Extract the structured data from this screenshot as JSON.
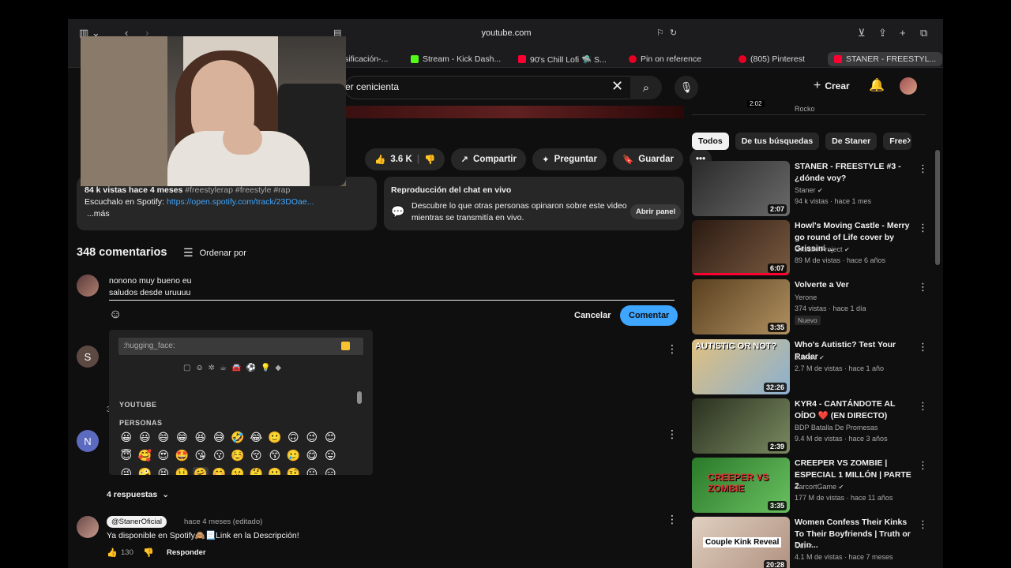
{
  "browser": {
    "url": "youtube.com",
    "tabs": [
      {
        "label": "sificación-..."
      },
      {
        "label": "Stream - Kick Dash..."
      },
      {
        "label": "90's Chill Lofi 🛸 S..."
      },
      {
        "label": "Pin on reference"
      },
      {
        "label": "(805) Pinterest"
      },
      {
        "label": "STANER - FREESTYL..."
      }
    ]
  },
  "header": {
    "search_value": "er cenicienta",
    "create_label": "Crear"
  },
  "video": {
    "likes": "3.6 K",
    "share_label": "Compartir",
    "ask_label": "Preguntar",
    "save_label": "Guardar",
    "desc_line1_views": "84 k vistas  hace 4 meses",
    "desc_line1_tags": "#freestylerap #freestyle #rap",
    "desc_line2_prefix": "Escuchalo en Spotify: ",
    "desc_link": "https://open.spotify.com/track/23DOae...",
    "desc_more": "...más",
    "chat_title": "Reproducción del chat en vivo",
    "chat_text": "Descubre lo que otras personas opinaron sobre este video mientras se transmitía en vivo.",
    "chat_button": "Abrir panel"
  },
  "comments": {
    "title": "348 comentarios",
    "sort_label": "Ordenar por",
    "draft_line1": "nonono muy bueno eu",
    "draft_line2": "saludos desde uruuuu",
    "cancel_label": "Cancelar",
    "comment_label": "Comentar",
    "replies_label": "4 respuestas",
    "pinned": {
      "handle": "@StanerOficial",
      "meta": "hace 4 meses (editado)",
      "text": "Ya disponible en Spotify🙈📃Link en la Descripción!",
      "likes": "130",
      "reply_label": "Responder"
    },
    "avatars": [
      "S",
      "N"
    ],
    "partial_3": "3"
  },
  "emoji_picker": {
    "search_text": ":hugging_face:",
    "section_youtube": "YOUTUBE",
    "section_people": "PERSONAS",
    "rows": [
      [
        "😀",
        "😃",
        "😄",
        "😁",
        "😆",
        "😅",
        "🤣",
        "😂",
        "🙂",
        "🙃",
        "😉",
        "😊"
      ],
      [
        "😇",
        "🥰",
        "😍",
        "🤩",
        "😘",
        "😗",
        "☺️",
        "😚",
        "😙",
        "🥲",
        "😋",
        "😛"
      ],
      [
        "😜",
        "🤪",
        "😝",
        "🤑",
        "🤗",
        "🤭",
        "🤫",
        "🤔",
        "🤐",
        "🤨",
        "😐",
        "😑"
      ]
    ],
    "category_icons": [
      "▢",
      "☺",
      "✲",
      "☕",
      "🚘",
      "⚽",
      "💡",
      "◆"
    ]
  },
  "sidebar": {
    "prev_channel": "Rocko",
    "prev_duration": "2:02",
    "chips": [
      "Todos",
      "De tus búsquedas",
      "De Staner",
      "Free"
    ],
    "items": [
      {
        "title": "STANER - FREESTYLE #3 - ¿dónde voy?",
        "channel": "Staner",
        "meta": "94 k vistas · hace 1 mes",
        "duration": "2:07",
        "thumb": "#4a4a4a"
      },
      {
        "title": "Howl's Moving Castle - Merry go round of Life cover by Grissini ...",
        "channel": "Grissini Project",
        "meta": "89 M de vistas · hace 6 años",
        "duration": "6:07",
        "thumb": "#5a4030"
      },
      {
        "title": "Volverte a Ver",
        "channel": "Yerone",
        "meta": "374 vistas · hace 1 día",
        "duration": "3:35",
        "badge": "Nuevo",
        "thumb": "#8a6a3a"
      },
      {
        "title": "Who's Autistic? Test Your Radar",
        "channel": "Jubilee",
        "meta": "2.7 M de vistas · hace 1 año",
        "duration": "32:26",
        "thumb": "#c0a070",
        "overlay": "AUTISTIC OR NOT?"
      },
      {
        "title": "KYR4 - CANTÁNDOTE AL OÍDO ❤️ (EN DIRECTO)",
        "channel": "BDP Batalla De Promesas",
        "meta": "9.4 M de vistas · hace 3 años",
        "duration": "2:39",
        "thumb": "#3a4a30"
      },
      {
        "title": "CREEPER VS ZOMBIE | ESPECIAL 1 MILLÓN | PARTE 2",
        "channel": "ZarcortGame",
        "meta": "177 M de vistas · hace 11 años",
        "duration": "3:35",
        "thumb": "#3a8a3a",
        "overlay": "CREEPER VS ZOMBIE"
      },
      {
        "title": "Women Confess Their Kinks To Their Boyfriends | Truth or Drin...",
        "channel": "Cut",
        "meta": "4.1 M de vistas · hace 7 meses",
        "duration": "20:28",
        "thumb": "#c8b8a8",
        "overlay": "Couple Kink Reveal"
      }
    ]
  },
  "colors": {
    "accent_blue": "#3ea6ff",
    "youtube_red": "#ff0033",
    "bg": "#0f0f0f",
    "surface": "#272727"
  }
}
